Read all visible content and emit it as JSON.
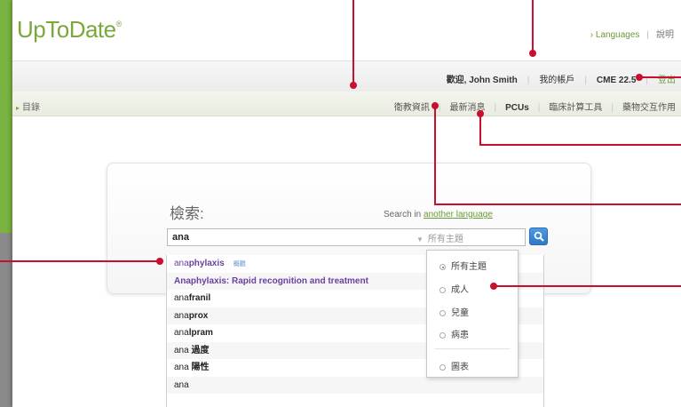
{
  "header": {
    "logo_text": "UpToDate",
    "logo_reg": "®",
    "languages_link": "› Languages",
    "help_link": "說明"
  },
  "userbar": {
    "welcome_label": "歡迎,",
    "user_name": "John Smith",
    "my_account": "我的帳戶",
    "cme_label": "CME 22.5",
    "logout": "登出"
  },
  "navbar": {
    "toc_label": "目錄",
    "items": [
      "衛教資訊",
      "最新消息",
      "PCUs",
      "臨床計算工具",
      "藥物交互作用"
    ]
  },
  "search": {
    "title": "檢索:",
    "search_in_text": "Search in",
    "another_language": "another language",
    "query": "ana",
    "topic_selected": "所有主題"
  },
  "autocomplete": {
    "items": [
      {
        "prefix": "ana",
        "rest": "phylaxis",
        "tag": "概觀"
      },
      {
        "prefix": "",
        "rest": "Anaphylaxis: Rapid recognition and treatment",
        "tag": ""
      },
      {
        "prefix": "ana",
        "rest": "franil",
        "tag": ""
      },
      {
        "prefix": "ana",
        "rest": "prox",
        "tag": ""
      },
      {
        "prefix": "ana",
        "rest": "lpram",
        "tag": ""
      },
      {
        "prefix": "ana",
        "rest": " 過度",
        "tag": ""
      },
      {
        "prefix": "ana",
        "rest": " 陽性",
        "tag": ""
      },
      {
        "prefix": "ana",
        "rest": "",
        "tag": ""
      }
    ]
  },
  "topic_menu": {
    "options": [
      "所有主題",
      "成人",
      "兒童",
      "病患",
      "圖表"
    ],
    "selected_index": 0
  },
  "colors": {
    "brand_green": "#7aa83a",
    "callout_red": "#c8102e",
    "search_blue": "#2e78c6",
    "autocomplete_highlight": "#6b3fa0"
  }
}
